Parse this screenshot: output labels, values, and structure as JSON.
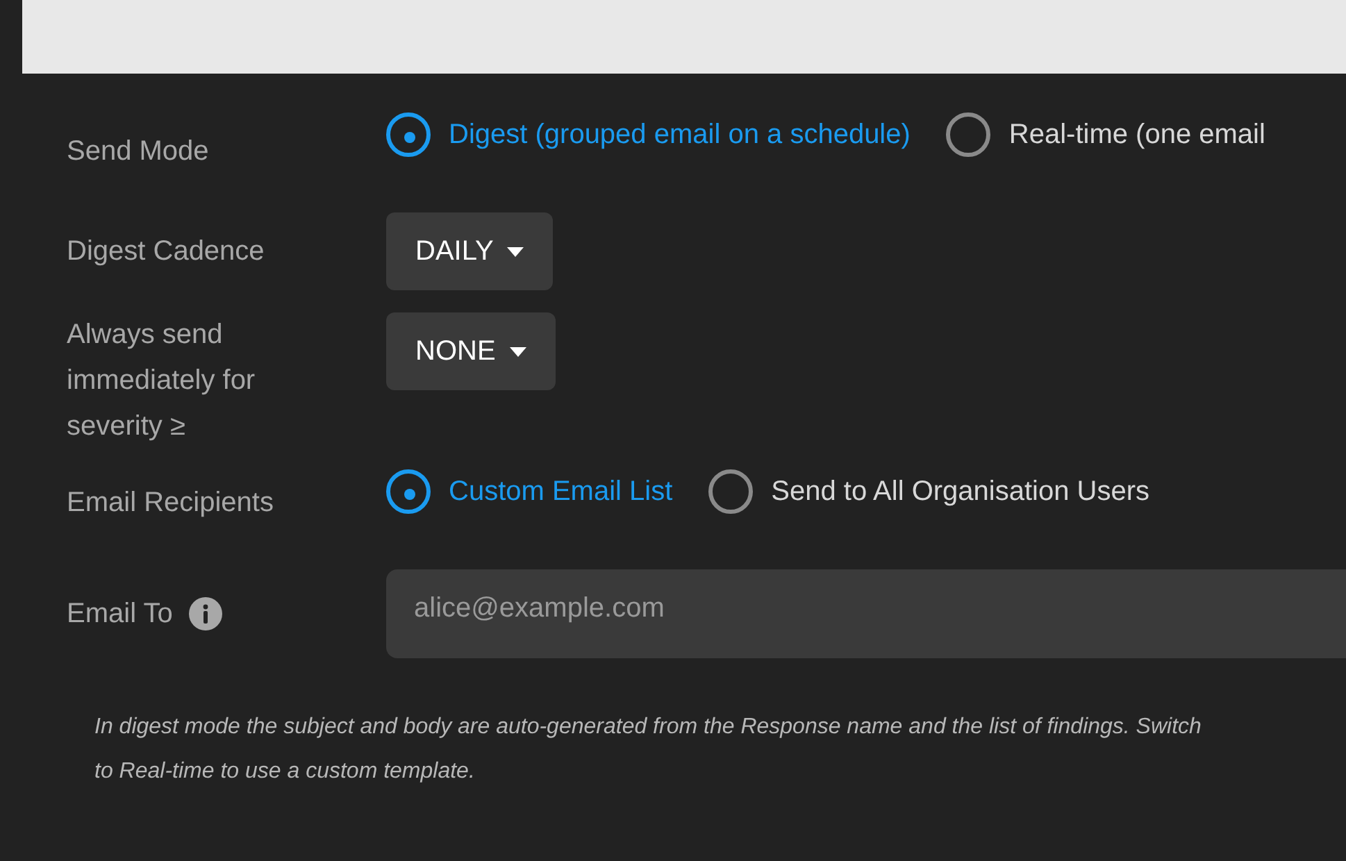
{
  "send_mode": {
    "label": "Send Mode",
    "options": [
      {
        "label": "Digest (grouped email on a schedule)",
        "selected": true
      },
      {
        "label": "Real-time (one email",
        "selected": false
      }
    ]
  },
  "digest_cadence": {
    "label": "Digest Cadence",
    "value": "DAILY"
  },
  "severity_threshold": {
    "label": "Always send immediately for severity ≥",
    "value": "NONE"
  },
  "email_recipients": {
    "label": "Email Recipients",
    "options": [
      {
        "label": "Custom Email List",
        "selected": true
      },
      {
        "label": "Send to All Organisation Users",
        "selected": false
      }
    ]
  },
  "email_to": {
    "label": "Email To",
    "placeholder": "alice@example.com"
  },
  "note": "In digest mode the subject and body are auto-generated from the Response name and the list of findings. Switch to Real-time to use a custom template."
}
